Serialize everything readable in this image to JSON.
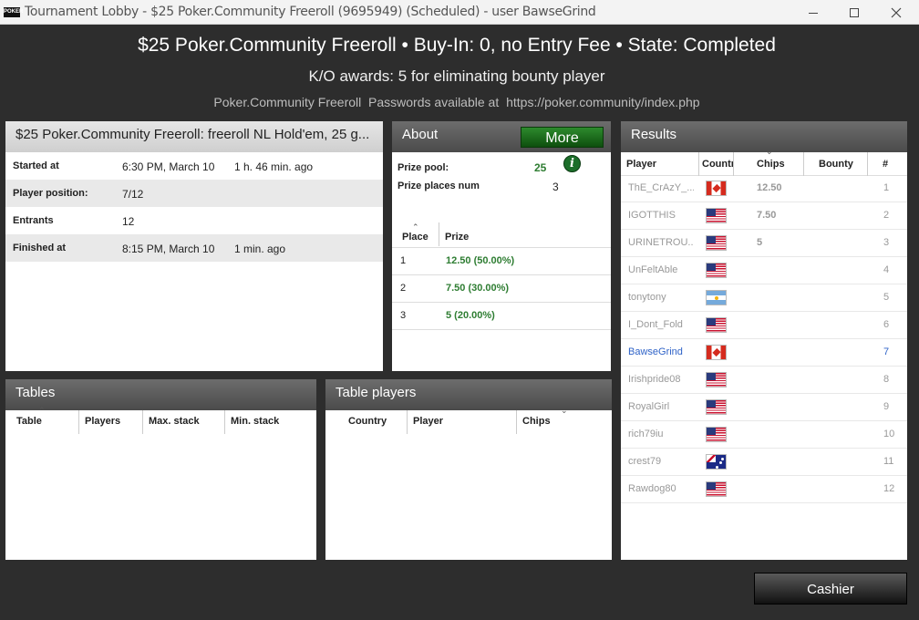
{
  "window": {
    "title": "Tournament Lobby - $25 Poker.Community Freeroll (9695949) (Scheduled) - user BawseGrind",
    "logo": "POKER"
  },
  "header": {
    "line1": "$25 Poker.Community Freeroll • Buy-In: 0, no Entry Fee • State: Completed",
    "line2": "K/O awards: 5 for eliminating bounty player",
    "line3_label": "Poker.Community Freeroll  Passwords available at",
    "line3_url": "https://poker.community/index.php"
  },
  "info": {
    "title": "$25 Poker.Community Freeroll: freeroll NL Hold'em, 25 g...",
    "rows": [
      {
        "label": "Started at",
        "value": "6:30 PM, March 10",
        "extra": "1 h. 46 min. ago"
      },
      {
        "label": "Player position:",
        "value": "7/12",
        "extra": ""
      },
      {
        "label": "Entrants",
        "value": "12",
        "extra": ""
      },
      {
        "label": "Finished at",
        "value": "8:15 PM, March 10",
        "extra": "1 min. ago"
      }
    ]
  },
  "about": {
    "title": "About",
    "more_label": "More",
    "prize_pool_label": "Prize pool:",
    "prize_pool_value": "25",
    "prize_places_label": "Prize places num",
    "prize_places_value": "3",
    "columns": [
      "Place",
      "Prize"
    ],
    "prizes": [
      {
        "place": "1",
        "prize": "12.50 (50.00%)"
      },
      {
        "place": "2",
        "prize": "7.50 (30.00%)"
      },
      {
        "place": "3",
        "prize": "5 (20.00%)"
      }
    ]
  },
  "results": {
    "title": "Results",
    "columns": [
      "Player",
      "Countr",
      "Chips",
      "Bounty",
      "#"
    ],
    "rows": [
      {
        "player": "ThE_CrAzY_...",
        "flag": "ca",
        "chips": "12.50",
        "rank": "1"
      },
      {
        "player": "IGOTTHIS",
        "flag": "us",
        "chips": "7.50",
        "rank": "2"
      },
      {
        "player": "URINETROU...",
        "flag": "us",
        "chips": "5",
        "rank": "3"
      },
      {
        "player": "UnFeltAble",
        "flag": "us",
        "chips": "",
        "rank": "4"
      },
      {
        "player": "tonytony",
        "flag": "ar",
        "chips": "",
        "rank": "5"
      },
      {
        "player": "I_Dont_Fold",
        "flag": "us",
        "chips": "",
        "rank": "6"
      },
      {
        "player": "BawseGrind",
        "flag": "ca",
        "chips": "",
        "rank": "7"
      },
      {
        "player": "Irishpride08",
        "flag": "us",
        "chips": "",
        "rank": "8"
      },
      {
        "player": "RoyalGirl",
        "flag": "us",
        "chips": "",
        "rank": "9"
      },
      {
        "player": "rich79iu",
        "flag": "us",
        "chips": "",
        "rank": "10"
      },
      {
        "player": "crest79",
        "flag": "au",
        "chips": "",
        "rank": "11"
      },
      {
        "player": "Rawdog80",
        "flag": "us",
        "chips": "",
        "rank": "12"
      }
    ]
  },
  "tables": {
    "title": "Tables",
    "columns": [
      "Table",
      "Players",
      "Max. stack",
      "Min. stack"
    ]
  },
  "table_players": {
    "title": "Table players",
    "columns": [
      "Country",
      "Player",
      "Chips"
    ]
  },
  "cashier_label": "Cashier",
  "colors": {
    "green": "#2e7d32",
    "blue": "#2f63c8"
  }
}
